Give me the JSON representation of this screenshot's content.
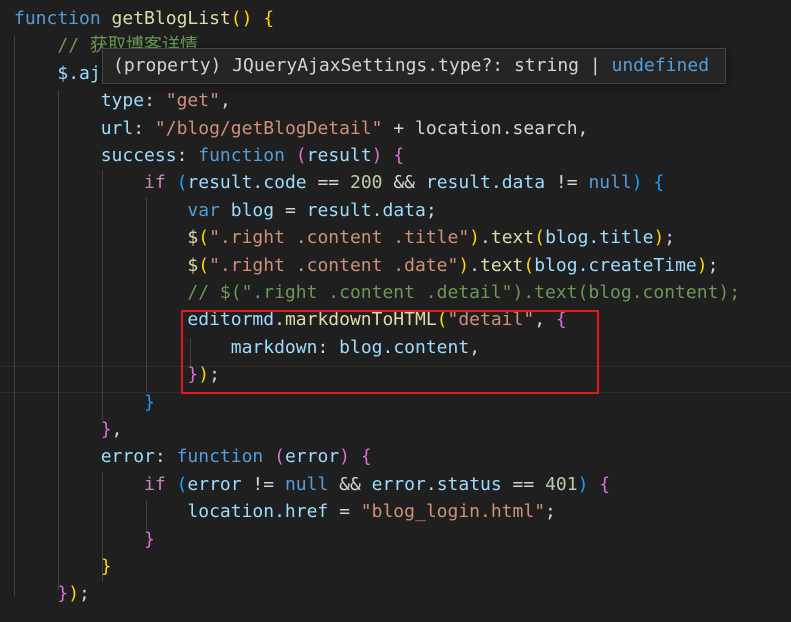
{
  "editor": {
    "lines": [
      [
        {
          "t": "function ",
          "c": "kw"
        },
        {
          "t": "getBlogList",
          "c": "fn"
        },
        {
          "t": "() ",
          "c": "p1"
        },
        {
          "t": "{",
          "c": "p1"
        }
      ],
      [
        {
          "t": "    ",
          "c": "plain"
        },
        {
          "t": "// 获取博客详情",
          "c": "cmt"
        }
      ],
      [
        {
          "t": "    ",
          "c": "plain"
        },
        {
          "t": "$.aj",
          "c": "var"
        }
      ],
      [
        {
          "t": "        ",
          "c": "plain"
        },
        {
          "t": "type",
          "c": "var"
        },
        {
          "t": ": ",
          "c": "plain"
        },
        {
          "t": "\"get\"",
          "c": "str"
        },
        {
          "t": ",",
          "c": "plain"
        }
      ],
      [
        {
          "t": "        ",
          "c": "plain"
        },
        {
          "t": "url",
          "c": "var"
        },
        {
          "t": ": ",
          "c": "plain"
        },
        {
          "t": "\"/blog/getBlogDetail\"",
          "c": "str"
        },
        {
          "t": " + location.search,",
          "c": "plain"
        }
      ],
      [
        {
          "t": "        ",
          "c": "plain"
        },
        {
          "t": "success",
          "c": "var"
        },
        {
          "t": ": ",
          "c": "plain"
        },
        {
          "t": "function ",
          "c": "kw"
        },
        {
          "t": "(",
          "c": "p2"
        },
        {
          "t": "result",
          "c": "var"
        },
        {
          "t": ") ",
          "c": "p2"
        },
        {
          "t": "{",
          "c": "p2"
        }
      ],
      [
        {
          "t": "            ",
          "c": "plain"
        },
        {
          "t": "if ",
          "c": "ctl"
        },
        {
          "t": "(",
          "c": "p3"
        },
        {
          "t": "result.code",
          "c": "var"
        },
        {
          "t": " == ",
          "c": "plain"
        },
        {
          "t": "200",
          "c": "num"
        },
        {
          "t": " && ",
          "c": "plain"
        },
        {
          "t": "result.data",
          "c": "var"
        },
        {
          "t": " != ",
          "c": "plain"
        },
        {
          "t": "null",
          "c": "kw"
        },
        {
          "t": ") ",
          "c": "p3"
        },
        {
          "t": "{",
          "c": "p3"
        }
      ],
      [
        {
          "t": "                ",
          "c": "plain"
        },
        {
          "t": "var ",
          "c": "kw"
        },
        {
          "t": "blog",
          "c": "var"
        },
        {
          "t": " = ",
          "c": "plain"
        },
        {
          "t": "result.data",
          "c": "var"
        },
        {
          "t": ";",
          "c": "plain"
        }
      ],
      [
        {
          "t": "                ",
          "c": "plain"
        },
        {
          "t": "$",
          "c": "fn"
        },
        {
          "t": "(",
          "c": "p1"
        },
        {
          "t": "\".right .content .title\"",
          "c": "str"
        },
        {
          "t": ")",
          "c": "p1"
        },
        {
          "t": ".",
          "c": "plain"
        },
        {
          "t": "text",
          "c": "fn"
        },
        {
          "t": "(",
          "c": "p1"
        },
        {
          "t": "blog.title",
          "c": "var"
        },
        {
          "t": ")",
          "c": "p1"
        },
        {
          "t": ";",
          "c": "plain"
        }
      ],
      [
        {
          "t": "                ",
          "c": "plain"
        },
        {
          "t": "$",
          "c": "fn"
        },
        {
          "t": "(",
          "c": "p1"
        },
        {
          "t": "\".right .content .date\"",
          "c": "str"
        },
        {
          "t": ")",
          "c": "p1"
        },
        {
          "t": ".",
          "c": "plain"
        },
        {
          "t": "text",
          "c": "fn"
        },
        {
          "t": "(",
          "c": "p1"
        },
        {
          "t": "blog.createTime",
          "c": "var"
        },
        {
          "t": ")",
          "c": "p1"
        },
        {
          "t": ";",
          "c": "plain"
        }
      ],
      [
        {
          "t": "                ",
          "c": "plain"
        },
        {
          "t": "// $(\".right .content .detail\").text(blog.content);",
          "c": "cmt"
        }
      ],
      [
        {
          "t": "                ",
          "c": "plain"
        },
        {
          "t": "editormd",
          "c": "var"
        },
        {
          "t": ".",
          "c": "plain"
        },
        {
          "t": "markdownToHTML",
          "c": "fn"
        },
        {
          "t": "(",
          "c": "p1"
        },
        {
          "t": "\"detail\"",
          "c": "str"
        },
        {
          "t": ", ",
          "c": "plain"
        },
        {
          "t": "{",
          "c": "p2"
        }
      ],
      [
        {
          "t": "                    ",
          "c": "plain"
        },
        {
          "t": "markdown",
          "c": "var"
        },
        {
          "t": ": ",
          "c": "plain"
        },
        {
          "t": "blog.content",
          "c": "var"
        },
        {
          "t": ",",
          "c": "plain"
        }
      ],
      [
        {
          "t": "                ",
          "c": "plain"
        },
        {
          "t": "}",
          "c": "p2"
        },
        {
          "t": ")",
          "c": "p1"
        },
        {
          "t": ";",
          "c": "plain"
        }
      ],
      [
        {
          "t": "            ",
          "c": "plain"
        },
        {
          "t": "}",
          "c": "p3"
        }
      ],
      [
        {
          "t": "        ",
          "c": "plain"
        },
        {
          "t": "}",
          "c": "p2"
        },
        {
          "t": ",",
          "c": "plain"
        }
      ],
      [
        {
          "t": "        ",
          "c": "plain"
        },
        {
          "t": "error",
          "c": "var"
        },
        {
          "t": ": ",
          "c": "plain"
        },
        {
          "t": "function ",
          "c": "kw"
        },
        {
          "t": "(",
          "c": "p2"
        },
        {
          "t": "error",
          "c": "var"
        },
        {
          "t": ") ",
          "c": "p2"
        },
        {
          "t": "{",
          "c": "p2"
        }
      ],
      [
        {
          "t": "            ",
          "c": "plain"
        },
        {
          "t": "if ",
          "c": "ctl"
        },
        {
          "t": "(",
          "c": "p3"
        },
        {
          "t": "error",
          "c": "var"
        },
        {
          "t": " != ",
          "c": "plain"
        },
        {
          "t": "null",
          "c": "kw"
        },
        {
          "t": " && ",
          "c": "plain"
        },
        {
          "t": "error.status",
          "c": "var"
        },
        {
          "t": " == ",
          "c": "plain"
        },
        {
          "t": "401",
          "c": "num"
        },
        {
          "t": ") ",
          "c": "p3"
        },
        {
          "t": "{",
          "c": "p2"
        }
      ],
      [
        {
          "t": "                ",
          "c": "plain"
        },
        {
          "t": "location.href",
          "c": "var"
        },
        {
          "t": " = ",
          "c": "plain"
        },
        {
          "t": "\"blog_login.html\"",
          "c": "str"
        },
        {
          "t": ";",
          "c": "plain"
        }
      ],
      [
        {
          "t": "            ",
          "c": "plain"
        },
        {
          "t": "}",
          "c": "p2"
        }
      ],
      [
        {
          "t": "        ",
          "c": "plain"
        },
        {
          "t": "}",
          "c": "p1"
        }
      ],
      [
        {
          "t": "    ",
          "c": "plain"
        },
        {
          "t": "}",
          "c": "p2"
        },
        {
          "t": ")",
          "c": "p1"
        },
        {
          "t": ";",
          "c": "plain"
        }
      ]
    ]
  },
  "hover": {
    "prefix": "(property) JQueryAjaxSettings.type?: string | ",
    "type_keyword": "undefined"
  },
  "colors": {
    "background": "#1f1f1f",
    "keyword": "#569cd6",
    "string": "#ce9178",
    "highlight_box": "#e0191b"
  }
}
